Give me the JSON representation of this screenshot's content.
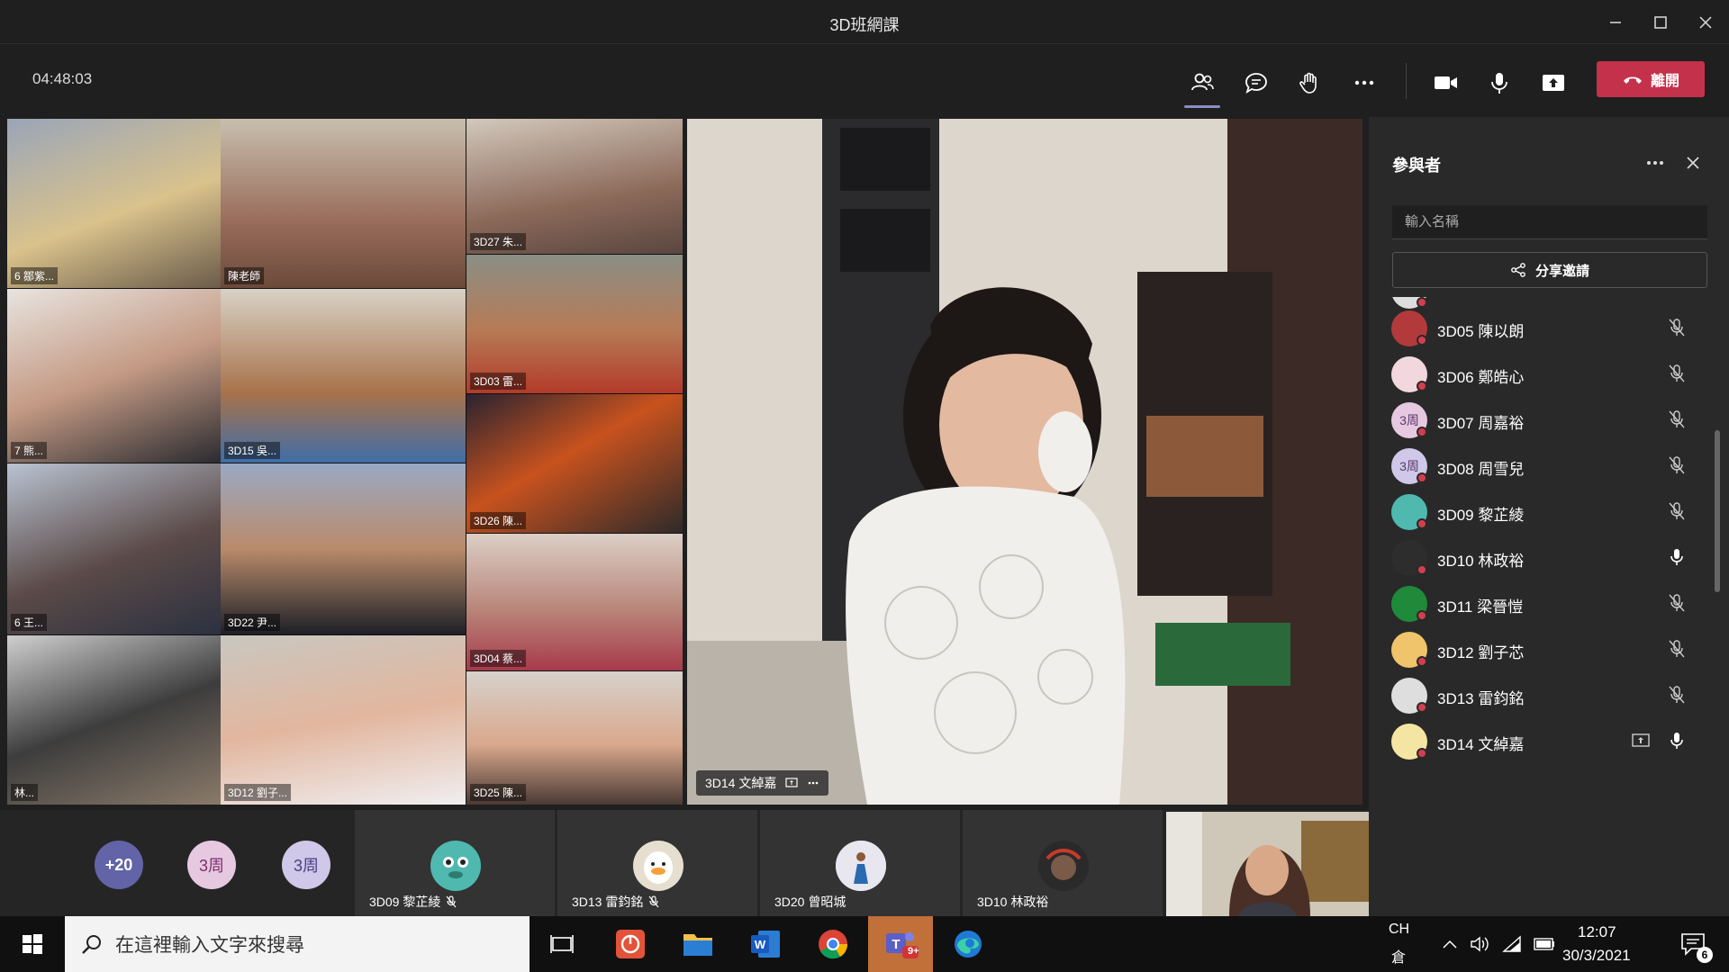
{
  "window": {
    "title": "3D班網課"
  },
  "toolbar": {
    "timer": "04:48:03",
    "buttons": [
      {
        "name": "participants-icon",
        "active": true
      },
      {
        "name": "chat-icon"
      },
      {
        "name": "raise-hand-icon"
      },
      {
        "name": "more-icon"
      },
      {
        "name": "camera-icon"
      },
      {
        "name": "mic-icon"
      },
      {
        "name": "share-screen-icon"
      }
    ],
    "leave_label": "離開"
  },
  "stage": {
    "grid_tags": [
      "6 鄒紫...",
      "陳老師",
      "3D27 朱...",
      "3D03 雷...",
      "7 熊...",
      "3D15 吳...",
      "3D26 陳...",
      "6 王...",
      "3D22 尹...",
      "3D04 蔡...",
      "林...",
      "3D12 劉子...",
      "3D25 陳..."
    ],
    "main_name": "3D14 文綽嘉"
  },
  "strip": {
    "overflow_count": "+20",
    "initial_avatars": [
      "3周",
      "3周"
    ],
    "tiles": [
      {
        "name": "3D09 黎芷綾",
        "muted": true,
        "color": "#4fb9b0"
      },
      {
        "name": "3D13 雷鈞銘",
        "muted": true,
        "color": "#e6dfd0"
      },
      {
        "name": "3D20 曾昭城",
        "muted": false,
        "color": "#d8d8e2"
      },
      {
        "name": "3D10 林政裕",
        "muted": false,
        "color": "#3a3a3a"
      }
    ]
  },
  "panel": {
    "title": "參與者",
    "search_placeholder": "輸入名稱",
    "share_label": "分享邀請",
    "participants": [
      {
        "name": "3D05 陳以朗",
        "mic": "muted",
        "avatar": "",
        "color": "#b23a3a"
      },
      {
        "name": "3D06 鄭皓心",
        "mic": "muted",
        "avatar": "",
        "color": "#f3d7de"
      },
      {
        "name": "3D07 周嘉裕",
        "mic": "muted",
        "avatar": "3周",
        "color": "#e7c8e1"
      },
      {
        "name": "3D08 周雪兒",
        "mic": "muted",
        "avatar": "3周",
        "color": "#cfc8e8"
      },
      {
        "name": "3D09 黎芷綾",
        "mic": "muted",
        "avatar": "",
        "color": "#4fb9b0"
      },
      {
        "name": "3D10 林政裕",
        "mic": "on",
        "avatar": "",
        "color": "#2d2d2d"
      },
      {
        "name": "3D11 梁晉愷",
        "mic": "muted",
        "avatar": "",
        "color": "#1e8a3a"
      },
      {
        "name": "3D12 劉子芯",
        "mic": "muted",
        "avatar": "",
        "color": "#f0c46a"
      },
      {
        "name": "3D13 雷鈞銘",
        "mic": "muted",
        "avatar": "",
        "color": "#dedede"
      },
      {
        "name": "3D14 文綽嘉",
        "mic": "on",
        "avatar": "",
        "color": "#f4e6a2",
        "sharing": true
      }
    ]
  },
  "taskbar": {
    "search_placeholder": "在這裡輸入文字來搜尋",
    "language": "CH",
    "ime": "倉",
    "time": "12:07",
    "date": "30/3/2021",
    "notifications": "6",
    "teams_badge": "9+"
  }
}
